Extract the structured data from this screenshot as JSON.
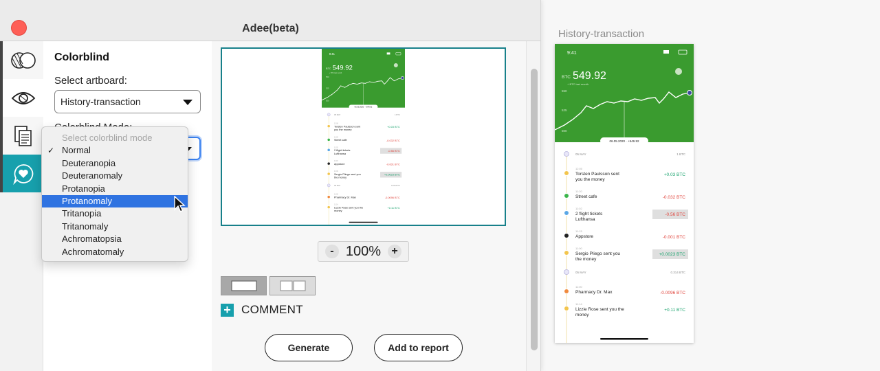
{
  "window": {
    "title": "Adee(beta)"
  },
  "panel": {
    "heading": "Colorblind",
    "artboard_label": "Select artboard:",
    "artboard_value": "History-transaction",
    "mode_label": "Colorblind Mode:"
  },
  "dropdown": {
    "placeholder": "Select colorblind mode",
    "checked_index": 0,
    "hover_index": 4,
    "options": [
      "Normal",
      "Deuteranopia",
      "Deuteranomaly",
      "Protanopia",
      "Protanomaly",
      "Tritanopia",
      "Tritanomaly",
      "Achromatopsia",
      "Achromatomaly"
    ]
  },
  "zoom": {
    "minus": "-",
    "value": "100",
    "unit": "%",
    "plus": "+"
  },
  "comment": {
    "plus": "+",
    "label": "COMMENT"
  },
  "buttons": {
    "generate": "Generate",
    "add_to_report": "Add to report"
  },
  "artboard_name": "History-transaction",
  "colors": {
    "accent": "#17a0ad",
    "green_header": "#3a9b2f",
    "positive": "#1aa36e",
    "negative": "#e0443c"
  },
  "phone": {
    "time": "9:41",
    "currency": "BTC",
    "balance": "549.92",
    "subtitle": "+ BTC last month",
    "chart_label": "06.05.2020 · +549.92",
    "y_ticks": [
      "550",
      "525",
      "500"
    ],
    "transactions": [
      {
        "kind": "date",
        "text": "05 MAY",
        "amount": "1 BTC"
      },
      {
        "kind": "tx",
        "time": "12:00",
        "title": "Torsten Paulsson sent you the money",
        "amount": "+0.03 BTC",
        "sign": "pos",
        "dot": "#f3c54d"
      },
      {
        "kind": "tx",
        "time": "11:20",
        "title": "Street cafe",
        "amount": "-0.032 BTC",
        "sign": "neg",
        "dot": "#3bb54a"
      },
      {
        "kind": "tx",
        "time": "11:02",
        "title": "2 flight tickets Lufthansa",
        "amount": "-0.56 BTC",
        "sign": "neg",
        "dot": "#5aa7e6",
        "boxed": true
      },
      {
        "kind": "tx",
        "time": "11:15",
        "title": "Appstore",
        "amount": "-0.001 BTC",
        "sign": "neg",
        "dot": "#222222"
      },
      {
        "kind": "tx",
        "time": "11:00",
        "title": "Sergio Pliego sent you the money",
        "amount": "+0.0023 BTC",
        "sign": "pos",
        "dot": "#f3c54d",
        "boxed": true
      },
      {
        "kind": "date",
        "text": "05 MAY",
        "amount": "0.314 BTC"
      },
      {
        "kind": "tx",
        "time": "11:00",
        "title": "Pharmacy Dr. Max",
        "amount": "-0.0096 BTC",
        "sign": "neg",
        "dot": "#f08a3e"
      },
      {
        "kind": "tx",
        "time": "11:14",
        "title": "Lizzie Rose sent you the money",
        "amount": "+0.11 BTC",
        "sign": "pos",
        "dot": "#f3c54d"
      }
    ]
  }
}
